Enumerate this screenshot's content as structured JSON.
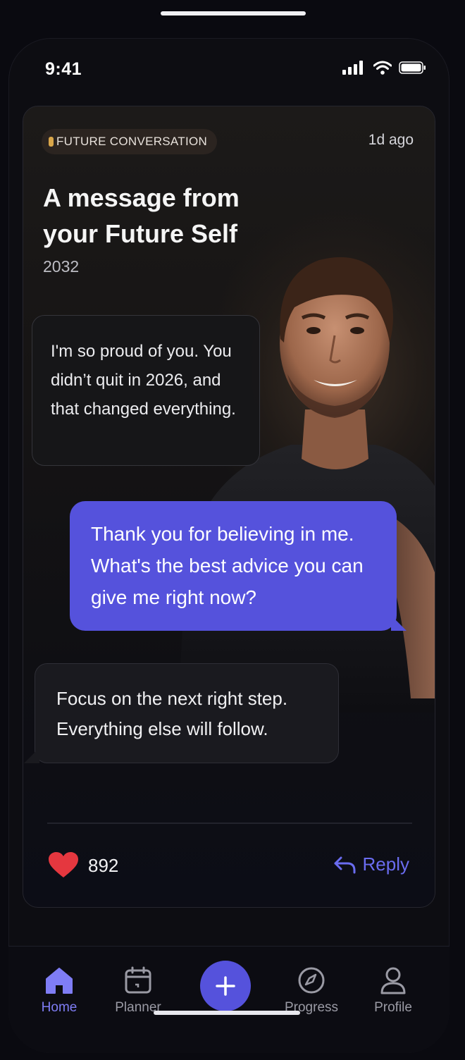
{
  "status_bar": {
    "time": "9:41"
  },
  "card": {
    "badge": "FUTURE CONVERSATION",
    "time_ago": "1d ago",
    "title": "A message from your Future Self",
    "year": "2032",
    "messages": [
      {
        "from": "future",
        "text": "I'm so proud of you. You didn’t quit in 2026, and that changed everything."
      },
      {
        "from": "me",
        "text": "Thank you for believing in me. What's the best advice you can give me right now?"
      },
      {
        "from": "future",
        "text": "Focus on the next right step. Everything else will follow."
      }
    ],
    "likes": "892",
    "reply_label": "Reply"
  },
  "tabs": [
    {
      "label": "Home",
      "icon": "home-icon",
      "active": true
    },
    {
      "label": "Planner",
      "icon": "calendar-icon"
    },
    {
      "label": "",
      "icon": "plus-icon"
    },
    {
      "label": "Progress",
      "icon": "compass-icon"
    },
    {
      "label": "Profile",
      "icon": "person-icon"
    }
  ],
  "colors": {
    "accent": "#5552dc",
    "heart": "#e5373f",
    "background": "#0d0d12"
  }
}
